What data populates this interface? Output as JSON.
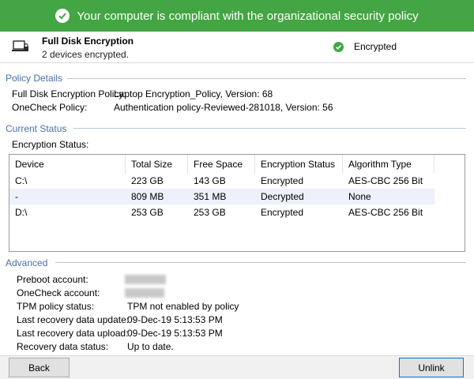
{
  "banner": {
    "text": "Your computer is compliant with the organizational security policy"
  },
  "header": {
    "title": "Full Disk Encryption",
    "subtitle": "2 devices encrypted.",
    "status": "Encrypted"
  },
  "policy": {
    "section_title": "Policy Details",
    "fde_label": "Full Disk Encryption Policy:",
    "fde_value": "Laptop Encryption_Policy, Version: 68",
    "onecheck_label": "OneCheck Policy:",
    "onecheck_value": "Authentication policy-Reviewed-281018, Version: 56"
  },
  "current": {
    "section_title": "Current Status",
    "encryption_label": "Encryption Status:",
    "columns": [
      "Device",
      "Total Size",
      "Free Space",
      "Encryption Status",
      "Algorithm Type"
    ],
    "rows": [
      [
        "C:\\",
        "223 GB",
        "143 GB",
        "Encrypted",
        "AES-CBC 256 Bit"
      ],
      [
        "-",
        "809 MB",
        "351 MB",
        "Decrypted",
        "None"
      ],
      [
        "D:\\",
        "253 GB",
        "253 GB",
        "Encrypted",
        "AES-CBC 256 Bit"
      ]
    ]
  },
  "advanced": {
    "section_title": "Advanced",
    "preboot_label": "Preboot account:",
    "onecheck_label": "OneCheck account:",
    "tpm_label": "TPM policy status:",
    "tpm_value": "TPM not enabled by policy",
    "update_label": "Last recovery data update:",
    "update_value": "09-Dec-19 5:13:53 PM",
    "upload_label": "Last recovery data upload:",
    "upload_value": "09-Dec-19 5:13:53 PM",
    "recovery_label": "Recovery data status:",
    "recovery_value": "Up to date."
  },
  "footer": {
    "back_label": "Back",
    "unlink_label": "Unlink"
  },
  "colors": {
    "banner": "#43a543",
    "section_title": "#4a6fa5",
    "alt_row": "#ecf1fa"
  },
  "icons": {
    "banner": "check-circle-icon",
    "device": "laptop-lock-icon",
    "status": "check-circle-icon"
  }
}
